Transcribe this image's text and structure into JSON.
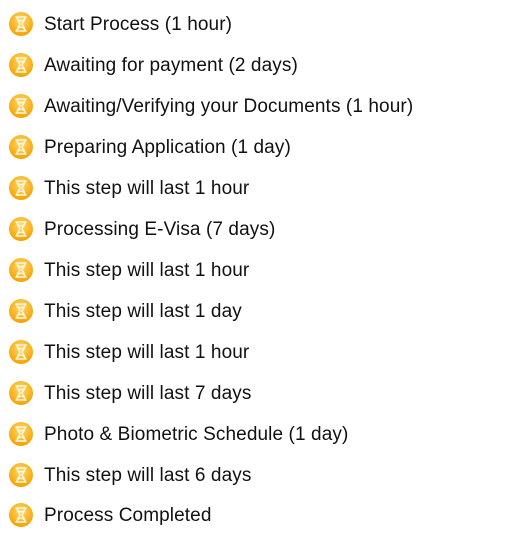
{
  "steps": [
    {
      "label": "Start Process (1 hour)",
      "icon": "hourglass-icon"
    },
    {
      "label": "Awaiting for payment (2 days)",
      "icon": "hourglass-icon"
    },
    {
      "label": "Awaiting/Verifying your Documents (1 hour)",
      "icon": "hourglass-icon"
    },
    {
      "label": "Preparing Application (1 day)",
      "icon": "hourglass-icon"
    },
    {
      "label": "This step will last 1 hour",
      "icon": "hourglass-icon"
    },
    {
      "label": "Processing E-Visa (7 days)",
      "icon": "hourglass-icon"
    },
    {
      "label": "This step will last 1 hour",
      "icon": "hourglass-icon"
    },
    {
      "label": "This step will last 1 day",
      "icon": "hourglass-icon"
    },
    {
      "label": "This step will last 1 hour",
      "icon": "hourglass-icon"
    },
    {
      "label": "This step will last 7 days",
      "icon": "hourglass-icon"
    },
    {
      "label": "Photo & Biometric Schedule (1 day)",
      "icon": "hourglass-icon"
    },
    {
      "label": "This step will last 6 days",
      "icon": "hourglass-icon"
    },
    {
      "label": "Process Completed",
      "icon": "hourglass-icon"
    }
  ],
  "colors": {
    "icon_outer": "#f4a100",
    "icon_inner": "#ffcc4d",
    "icon_glass": "#fff6dc"
  }
}
